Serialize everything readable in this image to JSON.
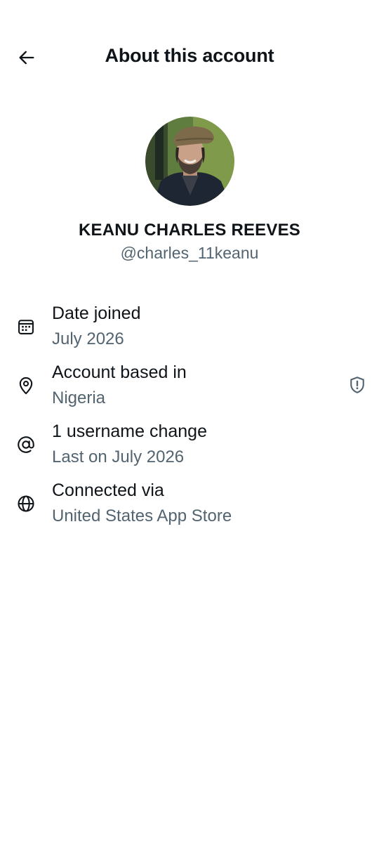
{
  "header": {
    "title": "About this account",
    "back_icon": "arrow-left-icon"
  },
  "profile": {
    "display_name": "KEANU CHARLES REEVES",
    "handle": "@charles_11keanu"
  },
  "rows": [
    {
      "icon": "calendar-icon",
      "label": "Date joined",
      "value": "July 2026"
    },
    {
      "icon": "location-pin-icon",
      "label": "Account based in",
      "value": "Nigeria",
      "trailing_icon": "shield-alert-icon"
    },
    {
      "icon": "at-sign-icon",
      "label": "1 username change",
      "value": "Last on July 2026"
    },
    {
      "icon": "globe-icon",
      "label": "Connected via",
      "value": "United States App Store"
    }
  ],
  "colors": {
    "primary_text": "#0f1419",
    "secondary_text": "#536471",
    "background": "#ffffff"
  }
}
